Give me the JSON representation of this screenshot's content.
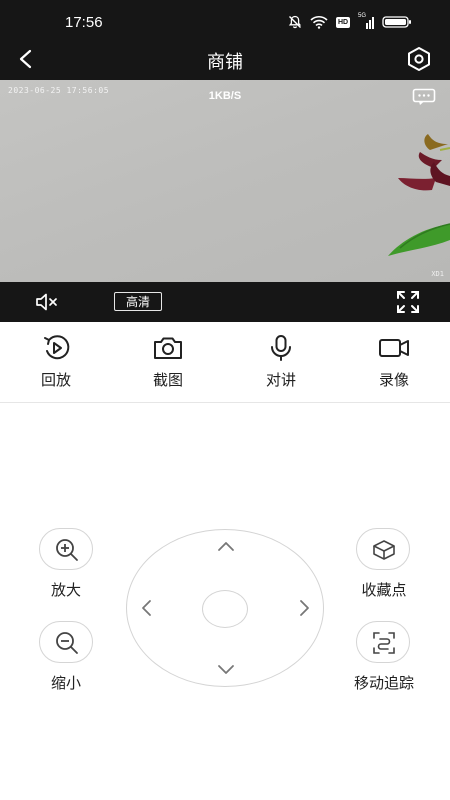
{
  "status_bar": {
    "time": "17:56",
    "icons": [
      "mute-bell-icon",
      "wifi-icon",
      "hd-icon",
      "signal-5g-icon",
      "battery-icon"
    ],
    "hd": "HD",
    "net": "5G"
  },
  "header": {
    "title": "商铺",
    "back_icon": "back-arrow-icon",
    "settings_icon": "settings-hex-icon"
  },
  "video": {
    "osd_timestamp": "2023-06-25  17:56:05",
    "bitrate": "1KB/S",
    "channel": "XD1",
    "message_icon": "message-icon"
  },
  "controls": {
    "quality": "高清",
    "mute_icon": "speaker-mute-icon",
    "fullscreen_icon": "fullscreen-icon"
  },
  "actions": [
    {
      "label": "回放",
      "icon": "playback-icon"
    },
    {
      "label": "截图",
      "icon": "camera-icon"
    },
    {
      "label": "对讲",
      "icon": "microphone-icon"
    },
    {
      "label": "录像",
      "icon": "video-record-icon"
    }
  ],
  "ptz": {
    "zoom_in": "放大",
    "zoom_out": "缩小",
    "favorite": "收藏点",
    "motion_track": "移动追踪"
  },
  "colors": {
    "bar_bg": "#161616",
    "video_bg": "#c0c0be",
    "text": "#222222",
    "border": "#d5d5d5"
  }
}
